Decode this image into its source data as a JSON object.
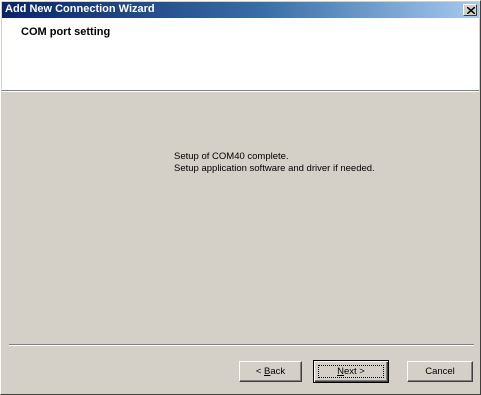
{
  "window": {
    "title": "Add New Connection Wizard"
  },
  "header": {
    "title": "COM port setting"
  },
  "content": {
    "line1": "Setup of COM40 complete.",
    "line2": "Setup application software and driver if needed."
  },
  "buttons": {
    "back": {
      "prefix": "< ",
      "mnemonic": "B",
      "rest": "ack"
    },
    "next": {
      "mnemonic": "N",
      "rest": "ext >"
    },
    "cancel": "Cancel"
  },
  "icons": {
    "close": "close-icon"
  },
  "colors": {
    "titlebar_start": "#0a246a",
    "titlebar_end": "#a6caf0",
    "face": "#d4d0c8"
  }
}
